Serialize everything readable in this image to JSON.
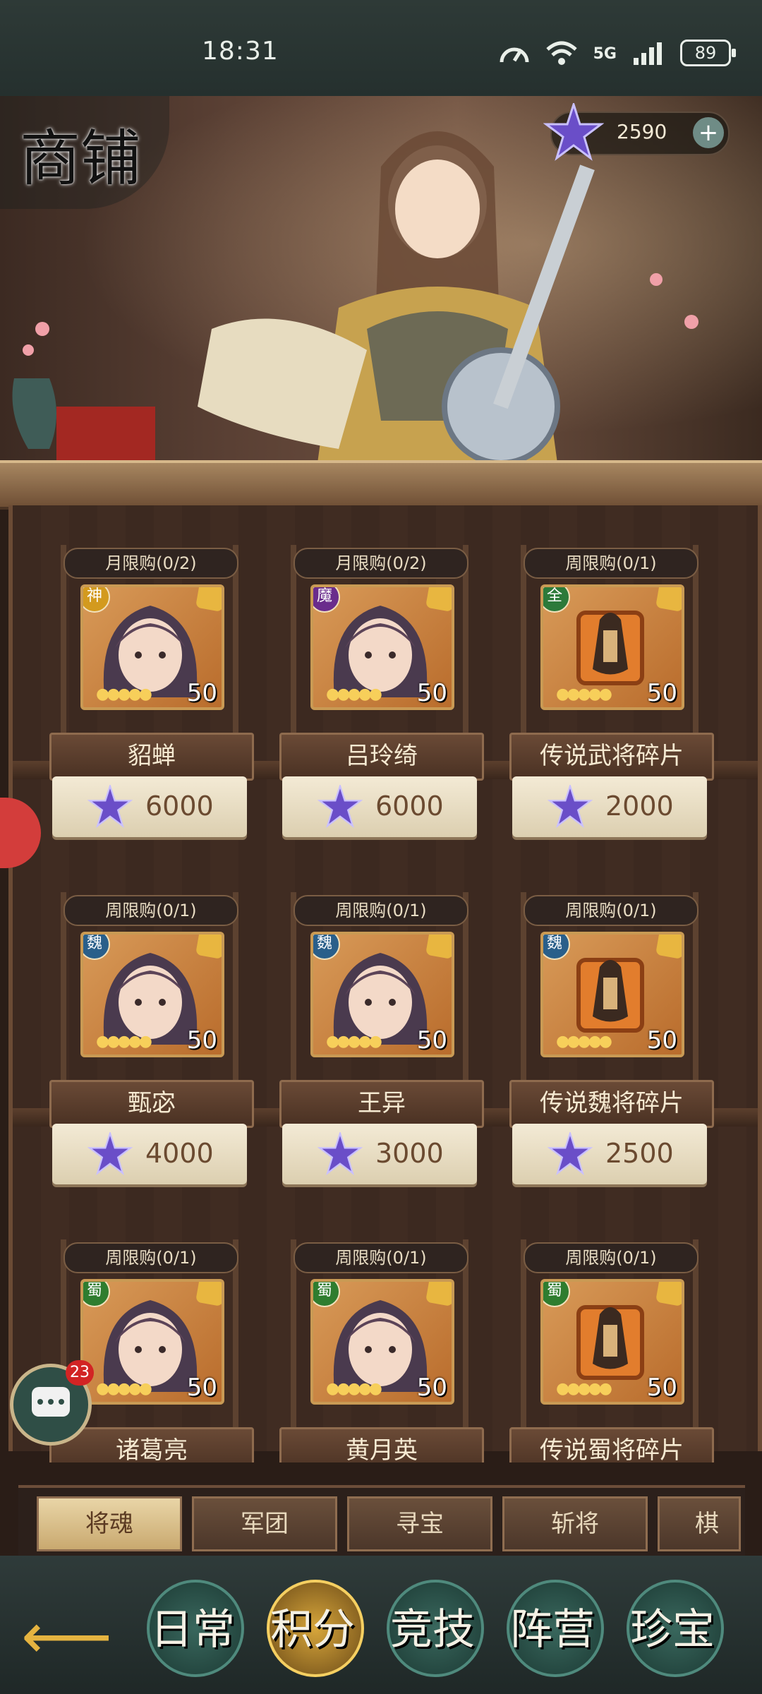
{
  "status": {
    "time": "18:31",
    "network": "5G",
    "battery": "89"
  },
  "banner": {
    "title": "商铺",
    "currency_value": "2590",
    "plus": "+"
  },
  "items": [
    {
      "limit": "月限购(0/2)",
      "faction": "神",
      "faction_color": "#d39a1e",
      "count": "50",
      "name": "貂蝉",
      "price": "6000",
      "type": "hero"
    },
    {
      "limit": "月限购(0/2)",
      "faction": "魔",
      "faction_color": "#6a2c8c",
      "count": "50",
      "name": "吕玲绮",
      "price": "6000",
      "type": "hero"
    },
    {
      "limit": "周限购(0/1)",
      "faction": "全",
      "faction_color": "#2c7a3a",
      "count": "50",
      "name": "传说武将碎片",
      "price": "2000",
      "type": "fragment"
    },
    {
      "limit": "周限购(0/1)",
      "faction": "魏",
      "faction_color": "#2a5f8a",
      "count": "50",
      "name": "甄宓",
      "price": "4000",
      "type": "hero"
    },
    {
      "limit": "周限购(0/1)",
      "faction": "魏",
      "faction_color": "#2a5f8a",
      "count": "50",
      "name": "王异",
      "price": "3000",
      "type": "hero"
    },
    {
      "limit": "周限购(0/1)",
      "faction": "魏",
      "faction_color": "#2a5f8a",
      "count": "50",
      "name": "传说魏将碎片",
      "price": "2500",
      "type": "fragment"
    },
    {
      "limit": "周限购(0/1)",
      "faction": "蜀",
      "faction_color": "#2f7d2f",
      "count": "50",
      "name": "诸葛亮",
      "price": "",
      "type": "hero"
    },
    {
      "limit": "周限购(0/1)",
      "faction": "蜀",
      "faction_color": "#2f7d2f",
      "count": "50",
      "name": "黄月英",
      "price": "",
      "type": "hero"
    },
    {
      "limit": "周限购(0/1)",
      "faction": "蜀",
      "faction_color": "#2f7d2f",
      "count": "50",
      "name": "传说蜀将碎片",
      "price": "",
      "type": "fragment"
    }
  ],
  "chat": {
    "badge": "23"
  },
  "tabs": [
    "将魂",
    "军团",
    "寻宝",
    "斩将",
    "棋"
  ],
  "bottom_nav": [
    "日常",
    "积分",
    "竞技",
    "阵营",
    "珍宝"
  ],
  "colors": {
    "accent_gold": "#e5b340",
    "tab_active": "#c9a96f"
  }
}
